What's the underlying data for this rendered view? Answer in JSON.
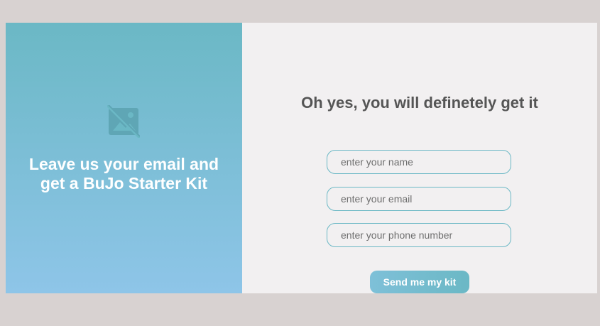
{
  "left_panel": {
    "icon": "broken-image-icon",
    "heading_line1": "Leave us your email and",
    "heading_line2": "get a BuJo Starter Kit",
    "gradient_top": "#6bb8c5",
    "gradient_bottom": "#8ec5e8"
  },
  "right_panel": {
    "heading": "Oh yes, you will definetely get it",
    "form": {
      "name_placeholder": "enter your name",
      "name_value": "",
      "email_placeholder": "enter your email",
      "email_value": "",
      "phone_placeholder": "enter your phone number",
      "phone_value": "",
      "submit_label": "Send me my kit"
    },
    "accent_color": "#6bb8c5",
    "background": "#f2f0f1"
  },
  "page_background": "#d8d2d1"
}
